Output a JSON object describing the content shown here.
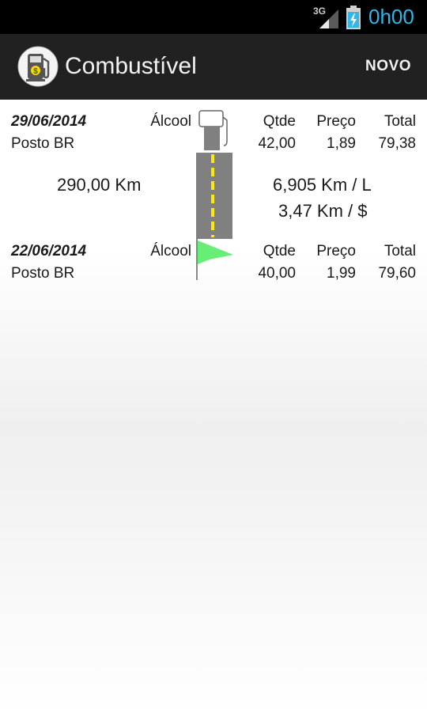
{
  "status_bar": {
    "network": "3G",
    "clock": "0h00",
    "icons": [
      "signal-icon",
      "battery-charging-icon"
    ]
  },
  "app_bar": {
    "title": "Combustível",
    "new_label": "NOVO",
    "icon": "fuel-pump-icon"
  },
  "entries": [
    {
      "date": "29/06/2014",
      "fuel": "Álcool",
      "station": "Posto BR",
      "headers": {
        "qty": "Qtde",
        "price": "Preço",
        "total": "Total"
      },
      "qty": "42,00",
      "price": "1,89",
      "total": "79,38"
    },
    {
      "date": "22/06/2014",
      "fuel": "Álcool",
      "station": "Posto BR",
      "headers": {
        "qty": "Qtde",
        "price": "Preço",
        "total": "Total"
      },
      "qty": "40,00",
      "price": "1,99",
      "total": "79,60"
    }
  ],
  "trip": {
    "distance": "290,00 Km",
    "km_per_liter": "6,905 Km / L",
    "km_per_currency": "3,47 Km / $"
  },
  "colors": {
    "accent": "#33b5e5",
    "road": "#808080",
    "road_line": "#ffeb00",
    "flag": "#66ee77"
  }
}
